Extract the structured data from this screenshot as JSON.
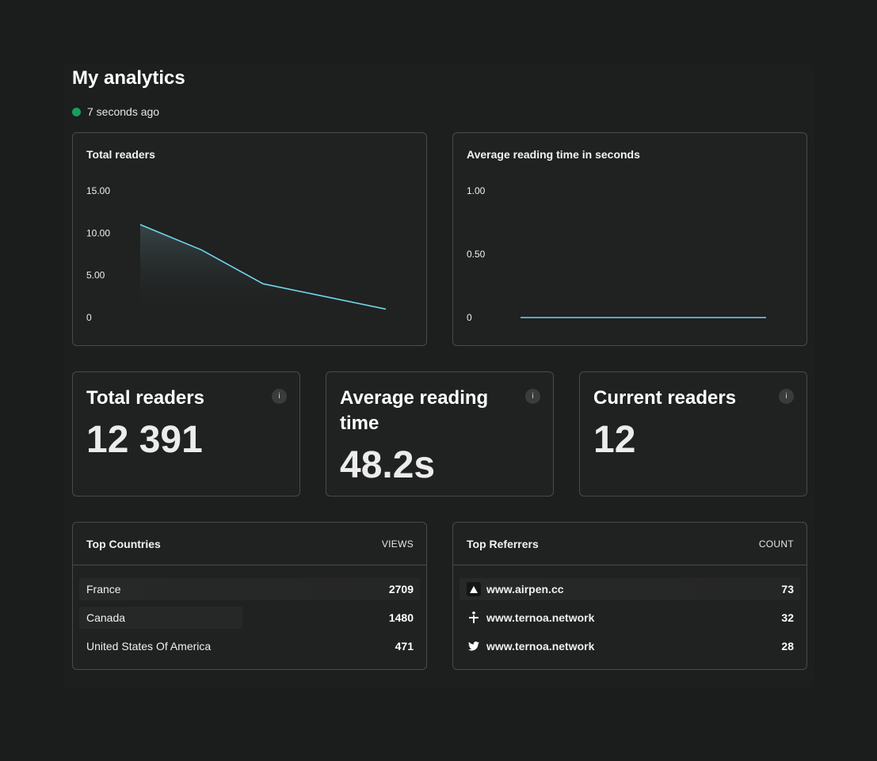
{
  "header": {
    "title": "My analytics",
    "status_text": "7 seconds ago",
    "status_color": "#16a05c"
  },
  "charts": [
    {
      "title": "Total readers",
      "chart_data": {
        "type": "area",
        "x": [
          1,
          2,
          3,
          4,
          5
        ],
        "values": [
          11,
          8,
          4,
          2.5,
          1
        ],
        "ylim": [
          0,
          15
        ],
        "y_ticks": [
          "15.00",
          "10.00",
          "5.00",
          "0"
        ],
        "y_tick_values": [
          15,
          10,
          5,
          0
        ],
        "line_color": "#6fd6ee"
      }
    },
    {
      "title": "Average reading time in seconds",
      "chart_data": {
        "type": "line",
        "x": [
          1,
          2
        ],
        "values": [
          0,
          0
        ],
        "ylim": [
          0,
          1
        ],
        "y_ticks": [
          "1.00",
          "0.50",
          "0"
        ],
        "y_tick_values": [
          1,
          0.5,
          0
        ],
        "line_color": "#6fd6ee"
      }
    }
  ],
  "stats": [
    {
      "label": "Total readers",
      "value": "12 391",
      "info": "i"
    },
    {
      "label": "Average reading time",
      "value": "48.2s",
      "info": "i"
    },
    {
      "label": "Current readers",
      "value": "12",
      "info": "i"
    }
  ],
  "countries": {
    "title": "Top Countries",
    "column": "VIEWS",
    "rows": [
      {
        "name": "France",
        "value": "2709"
      },
      {
        "name": "Canada",
        "value": "1480"
      },
      {
        "name": "United States Of America",
        "value": "471"
      }
    ]
  },
  "referrers": {
    "title": "Top Referrers",
    "column": "COUNT",
    "rows": [
      {
        "icon": "airpen-logo-icon",
        "name": "www.airpen.cc",
        "value": "73"
      },
      {
        "icon": "ternoa-logo-icon",
        "name": "www.ternoa.network",
        "value": "32"
      },
      {
        "icon": "twitter-icon",
        "name": "www.ternoa.network",
        "value": "28"
      }
    ]
  }
}
